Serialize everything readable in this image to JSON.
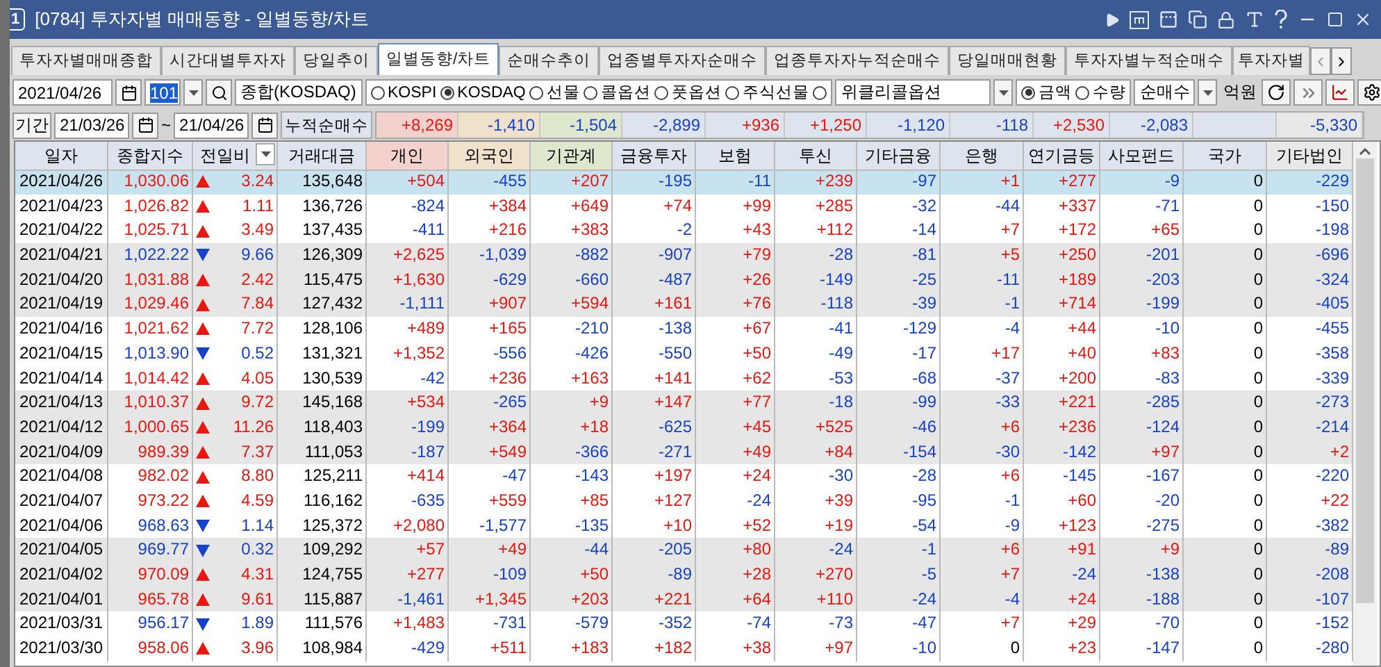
{
  "window": {
    "badge": "1",
    "title": "[0784] 투자자별 매매동향 - 일별동향/차트"
  },
  "tabs": [
    {
      "label": "투자자별매매종합",
      "selected": false
    },
    {
      "label": "시간대별투자자",
      "selected": false
    },
    {
      "label": "당일추이",
      "selected": false
    },
    {
      "label": "일별동향/차트",
      "selected": true
    },
    {
      "label": "순매수추이",
      "selected": false
    },
    {
      "label": "업종별투자자순매수",
      "selected": false
    },
    {
      "label": "업종투자자누적순매수",
      "selected": false
    },
    {
      "label": "당일매매현황",
      "selected": false
    },
    {
      "label": "투자자별누적순매수",
      "selected": false
    },
    {
      "label": "투자자별",
      "selected": false
    }
  ],
  "toolbar": {
    "date": "2021/04/26",
    "code": "101",
    "name": "종합(KOSDAQ)",
    "markets": [
      {
        "label": "KOSPI",
        "selected": false
      },
      {
        "label": "KOSDAQ",
        "selected": true
      },
      {
        "label": "선물",
        "selected": false
      },
      {
        "label": "콜옵션",
        "selected": false
      },
      {
        "label": "풋옵션",
        "selected": false
      },
      {
        "label": "주식선물",
        "selected": false
      }
    ],
    "weekly": {
      "selected": false,
      "value": "위클리콜옵션"
    },
    "units": [
      {
        "label": "금액",
        "selected": true
      },
      {
        "label": "수량",
        "selected": false
      }
    ],
    "mode": "순매수",
    "unit_label": "억원"
  },
  "period": {
    "label": "기간",
    "from": "21/03/26",
    "separator": "~",
    "to": "21/04/26",
    "summary_label": "누적순매수"
  },
  "table": {
    "columns": [
      {
        "label": "일자",
        "color": "#dde4ee"
      },
      {
        "label": "종합지수",
        "color": "#dde4ee"
      },
      {
        "label": "전일비",
        "color": "#dde4ee",
        "sortable": true
      },
      {
        "label": "거래대금",
        "color": "#dde4ee"
      },
      {
        "label": "개인",
        "color": "#f3d2ce",
        "total": "+8,269"
      },
      {
        "label": "외국인",
        "color": "#efe1ca",
        "total": "-1,410"
      },
      {
        "label": "기관계",
        "color": "#dfe8cd",
        "total": "-1,504"
      },
      {
        "label": "금융투자",
        "color": "#dde4ee",
        "total": "-2,899"
      },
      {
        "label": "보험",
        "color": "#dde4ee",
        "total": "+936"
      },
      {
        "label": "투신",
        "color": "#dde4ee",
        "total": "+1,250"
      },
      {
        "label": "기타금융",
        "color": "#dde4ee",
        "total": "-1,120"
      },
      {
        "label": "은행",
        "color": "#dde4ee",
        "total": "-118"
      },
      {
        "label": "연기금등",
        "color": "#dde4ee",
        "total": "+2,530"
      },
      {
        "label": "사모펀드",
        "color": "#dde4ee",
        "total": "-2,083"
      },
      {
        "label": "국가",
        "color": "#dde4ee"
      },
      {
        "label": "기타법인",
        "color": "#e8e8e8",
        "total": "-5,330"
      }
    ],
    "rows": [
      {
        "date": "2021/04/26",
        "index": "1,030.06",
        "rising": true,
        "change": "3.24",
        "amount": "135,648",
        "flows": [
          "+504",
          "-455",
          "+207",
          "-195",
          "-11",
          "+239",
          "-97",
          "+1",
          "+277",
          "-9",
          "0",
          "-229"
        ],
        "shaded": false,
        "selected": true
      },
      {
        "date": "2021/04/23",
        "index": "1,026.82",
        "rising": true,
        "change": "1.11",
        "amount": "136,726",
        "flows": [
          "-824",
          "+384",
          "+649",
          "+74",
          "+99",
          "+285",
          "-32",
          "-44",
          "+337",
          "-71",
          "0",
          "-150"
        ],
        "shaded": false,
        "selected": false
      },
      {
        "date": "2021/04/22",
        "index": "1,025.71",
        "rising": true,
        "change": "3.49",
        "amount": "137,435",
        "flows": [
          "-411",
          "+216",
          "+383",
          "-2",
          "+43",
          "+112",
          "-14",
          "+7",
          "+172",
          "+65",
          "0",
          "-198"
        ],
        "shaded": false,
        "selected": false
      },
      {
        "date": "2021/04/21",
        "index": "1,022.22",
        "rising": false,
        "change": "9.66",
        "amount": "126,309",
        "flows": [
          "+2,625",
          "-1,039",
          "-882",
          "-907",
          "+79",
          "-28",
          "-81",
          "+5",
          "+250",
          "-201",
          "0",
          "-696"
        ],
        "shaded": true,
        "selected": false
      },
      {
        "date": "2021/04/20",
        "index": "1,031.88",
        "rising": true,
        "change": "2.42",
        "amount": "115,475",
        "flows": [
          "+1,630",
          "-629",
          "-660",
          "-487",
          "+26",
          "-149",
          "-25",
          "-11",
          "+189",
          "-203",
          "0",
          "-324"
        ],
        "shaded": true,
        "selected": false
      },
      {
        "date": "2021/04/19",
        "index": "1,029.46",
        "rising": true,
        "change": "7.84",
        "amount": "127,432",
        "flows": [
          "-1,111",
          "+907",
          "+594",
          "+161",
          "+76",
          "-118",
          "-39",
          "-1",
          "+714",
          "-199",
          "0",
          "-405"
        ],
        "shaded": true,
        "selected": false
      },
      {
        "date": "2021/04/16",
        "index": "1,021.62",
        "rising": true,
        "change": "7.72",
        "amount": "128,106",
        "flows": [
          "+489",
          "+165",
          "-210",
          "-138",
          "+67",
          "-41",
          "-129",
          "-4",
          "+44",
          "-10",
          "0",
          "-455"
        ],
        "shaded": false,
        "selected": false
      },
      {
        "date": "2021/04/15",
        "index": "1,013.90",
        "rising": false,
        "change": "0.52",
        "amount": "131,321",
        "flows": [
          "+1,352",
          "-556",
          "-426",
          "-550",
          "+50",
          "-49",
          "-17",
          "+17",
          "+40",
          "+83",
          "0",
          "-358"
        ],
        "shaded": false,
        "selected": false
      },
      {
        "date": "2021/04/14",
        "index": "1,014.42",
        "rising": true,
        "change": "4.05",
        "amount": "130,539",
        "flows": [
          "-42",
          "+236",
          "+163",
          "+141",
          "+62",
          "-53",
          "-68",
          "-37",
          "+200",
          "-83",
          "0",
          "-339"
        ],
        "shaded": false,
        "selected": false
      },
      {
        "date": "2021/04/13",
        "index": "1,010.37",
        "rising": true,
        "change": "9.72",
        "amount": "145,168",
        "flows": [
          "+534",
          "-265",
          "+9",
          "+147",
          "+77",
          "-18",
          "-99",
          "-33",
          "+221",
          "-285",
          "0",
          "-273"
        ],
        "shaded": true,
        "selected": false
      },
      {
        "date": "2021/04/12",
        "index": "1,000.65",
        "rising": true,
        "change": "11.26",
        "amount": "118,403",
        "flows": [
          "-199",
          "+364",
          "+18",
          "-625",
          "+45",
          "+525",
          "-46",
          "+6",
          "+236",
          "-124",
          "0",
          "-214"
        ],
        "shaded": true,
        "selected": false
      },
      {
        "date": "2021/04/09",
        "index": "989.39",
        "rising": true,
        "change": "7.37",
        "amount": "111,053",
        "flows": [
          "-187",
          "+549",
          "-366",
          "-271",
          "+49",
          "+84",
          "-154",
          "-30",
          "-142",
          "+97",
          "0",
          "+2"
        ],
        "shaded": true,
        "selected": false
      },
      {
        "date": "2021/04/08",
        "index": "982.02",
        "rising": true,
        "change": "8.80",
        "amount": "125,211",
        "flows": [
          "+414",
          "-47",
          "-143",
          "+197",
          "+24",
          "-30",
          "-28",
          "+6",
          "-145",
          "-167",
          "0",
          "-220"
        ],
        "shaded": false,
        "selected": false
      },
      {
        "date": "2021/04/07",
        "index": "973.22",
        "rising": true,
        "change": "4.59",
        "amount": "116,162",
        "flows": [
          "-635",
          "+559",
          "+85",
          "+127",
          "-24",
          "+39",
          "-95",
          "-1",
          "+60",
          "-20",
          "0",
          "+22"
        ],
        "shaded": false,
        "selected": false
      },
      {
        "date": "2021/04/06",
        "index": "968.63",
        "rising": false,
        "change": "1.14",
        "amount": "125,372",
        "flows": [
          "+2,080",
          "-1,577",
          "-135",
          "+10",
          "+52",
          "+19",
          "-54",
          "-9",
          "+123",
          "-275",
          "0",
          "-382"
        ],
        "shaded": false,
        "selected": false
      },
      {
        "date": "2021/04/05",
        "index": "969.77",
        "rising": false,
        "change": "0.32",
        "amount": "109,292",
        "flows": [
          "+57",
          "+49",
          "-44",
          "-205",
          "+80",
          "-24",
          "-1",
          "+6",
          "+91",
          "+9",
          "0",
          "-89"
        ],
        "shaded": true,
        "selected": false
      },
      {
        "date": "2021/04/02",
        "index": "970.09",
        "rising": true,
        "change": "4.31",
        "amount": "124,755",
        "flows": [
          "+277",
          "-109",
          "+50",
          "-89",
          "+28",
          "+270",
          "-5",
          "+7",
          "-24",
          "-138",
          "0",
          "-208"
        ],
        "shaded": true,
        "selected": false
      },
      {
        "date": "2021/04/01",
        "index": "965.78",
        "rising": true,
        "change": "9.61",
        "amount": "115,887",
        "flows": [
          "-1,461",
          "+1,345",
          "+203",
          "+221",
          "+64",
          "+110",
          "-24",
          "-4",
          "+24",
          "-188",
          "0",
          "-107"
        ],
        "shaded": true,
        "selected": false
      },
      {
        "date": "2021/03/31",
        "index": "956.17",
        "rising": false,
        "change": "1.89",
        "amount": "111,576",
        "flows": [
          "+1,483",
          "-731",
          "-579",
          "-352",
          "-74",
          "-73",
          "-47",
          "+7",
          "+29",
          "-70",
          "0",
          "-152"
        ],
        "shaded": false,
        "selected": false
      },
      {
        "date": "2021/03/30",
        "index": "958.06",
        "rising": true,
        "change": "3.96",
        "amount": "108,984",
        "flows": [
          "-429",
          "+511",
          "+183",
          "+182",
          "+38",
          "+97",
          "-10",
          "0",
          "+23",
          "-147",
          "0",
          "-280"
        ],
        "shaded": false,
        "selected": false
      }
    ]
  }
}
